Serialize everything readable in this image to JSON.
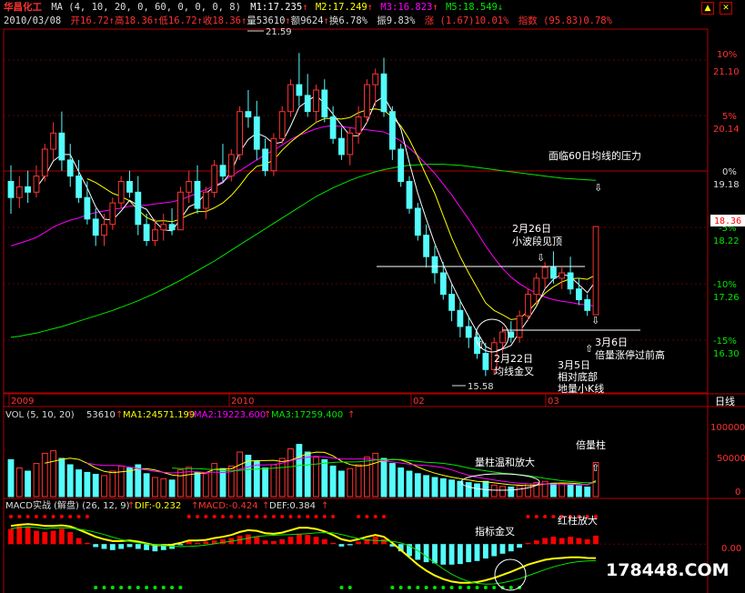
{
  "header": {
    "stock_name": "华昌化工",
    "ma_label": "MA (4, 10, 20, 0, 60, 0, 0, 0, 8)",
    "m1": "M1:17.235",
    "m2": "M2:17.249",
    "m3": "M3:16.823",
    "m5": "M5:18.549",
    "date": "2010/03/08",
    "open": "开16.72",
    "high": "高18.36",
    "low": "低16.72",
    "close": "收18.36",
    "volume": "量53610",
    "amount": "额9624",
    "turnover": "换6.78%",
    "amplitude": "振9.83%",
    "change": "涨 (1.67)10.01%",
    "index": "指数 (95.83)0.78%"
  },
  "vol_header": {
    "label": "VOL (5, 10, 20)",
    "value": "53610",
    "ma1": "MA1:24571.199",
    "ma2": "MA2:19223.600",
    "ma3": "MA3:17259.400"
  },
  "macd_header": {
    "label": "MACD实战 (解盘) (26, 12, 9)",
    "dif": "DIF:-0.232",
    "macd": "MACD:-0.424",
    "dea": "DEF:0.384"
  },
  "annotations": {
    "max_price": "21.59",
    "min_price": "15.58",
    "pressure": "面临60日均线的压力",
    "feb26": "2月26日",
    "feb26_b": "小波段见顶",
    "feb22": "2月22日",
    "feb22_b": "均线金叉",
    "mar5": "3月5日",
    "mar5_b": "相对底部",
    "mar5_c": "地量小K线",
    "mar6": "3月6日",
    "mar6_b": "倍量涨停过前高",
    "vol_mild": "量柱温和放大",
    "vol_double": "倍量柱",
    "macd_cross": "指标金叉",
    "macd_red": "红柱放大",
    "current_price": "18.36"
  },
  "time_axis": {
    "labels": [
      "2009",
      "2010",
      "02",
      "03"
    ],
    "period": "日线"
  },
  "price_axis": {
    "percent_labels": [
      "10%",
      "5%",
      "0%",
      "-5%",
      "-10%",
      "-15%"
    ],
    "price_labels": [
      "21.10",
      "20.14",
      "19.18",
      "18.22",
      "17.26",
      "16.30"
    ]
  },
  "vol_axis": [
    "100000",
    "50000",
    "0"
  ],
  "macd_axis": [
    "0.00"
  ],
  "watermark": "178448.COM",
  "window_buttons": [
    "▲",
    "✕"
  ],
  "colors": {
    "up": "#ff3232",
    "down": "#54fcfc",
    "ma4": "#ffffff",
    "ma10": "#ffff00",
    "ma20": "#ff00ff",
    "ma60": "#00e600",
    "grid": "#b00000"
  },
  "chart_data": {
    "type": "candlestick",
    "price_ylim": [
      15.3,
      22.0
    ],
    "candles": [
      [
        19.2,
        19.5,
        18.6,
        18.9
      ],
      [
        18.9,
        19.3,
        18.7,
        19.1
      ],
      [
        19.1,
        19.4,
        18.8,
        19.0
      ],
      [
        19.0,
        19.5,
        18.9,
        19.3
      ],
      [
        19.3,
        19.9,
        19.2,
        19.8
      ],
      [
        19.8,
        20.3,
        19.6,
        20.1
      ],
      [
        20.1,
        20.5,
        19.4,
        19.6
      ],
      [
        19.6,
        19.9,
        19.1,
        19.3
      ],
      [
        19.3,
        19.6,
        18.8,
        18.9
      ],
      [
        18.9,
        19.2,
        18.4,
        18.5
      ],
      [
        18.5,
        18.7,
        18.0,
        18.2
      ],
      [
        18.2,
        18.6,
        18.0,
        18.4
      ],
      [
        18.4,
        18.9,
        18.3,
        18.8
      ],
      [
        18.8,
        19.3,
        18.7,
        19.2
      ],
      [
        19.2,
        19.4,
        18.9,
        19.0
      ],
      [
        19.0,
        19.3,
        18.2,
        18.4
      ],
      [
        18.4,
        18.6,
        18.0,
        18.1
      ],
      [
        18.1,
        18.5,
        18.0,
        18.3
      ],
      [
        18.3,
        18.6,
        18.1,
        18.4
      ],
      [
        18.4,
        18.7,
        18.2,
        18.3
      ],
      [
        18.3,
        19.1,
        18.3,
        19.0
      ],
      [
        19.0,
        19.4,
        18.8,
        19.2
      ],
      [
        19.2,
        19.5,
        18.6,
        18.7
      ],
      [
        18.7,
        19.1,
        18.5,
        19.0
      ],
      [
        19.0,
        19.6,
        18.9,
        19.5
      ],
      [
        19.5,
        19.9,
        19.2,
        19.3
      ],
      [
        19.3,
        19.8,
        19.2,
        19.7
      ],
      [
        19.7,
        20.6,
        19.6,
        20.5
      ],
      [
        20.5,
        20.9,
        20.2,
        20.4
      ],
      [
        20.4,
        20.7,
        19.6,
        19.8
      ],
      [
        19.8,
        20.0,
        19.3,
        19.4
      ],
      [
        19.4,
        20.1,
        19.3,
        20.0
      ],
      [
        20.0,
        20.6,
        19.9,
        20.5
      ],
      [
        20.5,
        21.1,
        20.4,
        21.0
      ],
      [
        21.0,
        21.59,
        20.6,
        20.8
      ],
      [
        20.8,
        21.2,
        20.4,
        20.5
      ],
      [
        20.5,
        21.0,
        20.3,
        20.9
      ],
      [
        20.9,
        21.1,
        20.3,
        20.4
      ],
      [
        20.4,
        20.6,
        19.9,
        20.0
      ],
      [
        20.0,
        20.2,
        19.6,
        19.7
      ],
      [
        19.7,
        20.2,
        19.5,
        20.1
      ],
      [
        20.1,
        20.6,
        19.9,
        20.4
      ],
      [
        20.4,
        21.1,
        20.3,
        21.0
      ],
      [
        21.0,
        21.3,
        20.6,
        21.2
      ],
      [
        21.2,
        21.5,
        20.4,
        20.5
      ],
      [
        20.5,
        20.6,
        19.6,
        19.8
      ],
      [
        19.8,
        19.9,
        19.1,
        19.2
      ],
      [
        19.2,
        19.3,
        18.6,
        18.7
      ],
      [
        18.7,
        18.8,
        18.1,
        18.2
      ],
      [
        18.2,
        18.4,
        17.6,
        17.8
      ],
      [
        17.8,
        18.0,
        17.3,
        17.5
      ],
      [
        17.5,
        17.7,
        17.0,
        17.1
      ],
      [
        17.1,
        17.3,
        16.6,
        16.8
      ],
      [
        16.8,
        17.0,
        16.3,
        16.5
      ],
      [
        16.5,
        16.7,
        16.1,
        16.3
      ],
      [
        16.3,
        16.4,
        15.9,
        16.0
      ],
      [
        16.0,
        16.2,
        15.58,
        15.7
      ],
      [
        15.7,
        16.3,
        15.6,
        16.2
      ],
      [
        16.2,
        16.5,
        16.0,
        16.4
      ],
      [
        16.4,
        16.6,
        16.2,
        16.3
      ],
      [
        16.3,
        16.8,
        16.2,
        16.7
      ],
      [
        16.7,
        17.2,
        16.6,
        17.1
      ],
      [
        17.1,
        17.5,
        16.9,
        17.4
      ],
      [
        17.4,
        17.7,
        17.2,
        17.6
      ],
      [
        17.6,
        17.9,
        17.3,
        17.4
      ],
      [
        17.4,
        17.6,
        17.2,
        17.5
      ],
      [
        17.5,
        17.8,
        17.1,
        17.2
      ],
      [
        17.2,
        17.4,
        16.9,
        17.0
      ],
      [
        17.0,
        17.1,
        16.7,
        16.8
      ],
      [
        16.72,
        18.36,
        16.72,
        18.36
      ]
    ],
    "ma4": [
      null,
      null,
      null,
      19.08,
      19.3,
      19.58,
      19.7,
      19.7,
      19.38,
      19.08,
      18.73,
      18.5,
      18.48,
      18.65,
      18.85,
      18.75,
      18.68,
      18.45,
      18.3,
      18.28,
      18.5,
      18.73,
      18.8,
      18.98,
      19.1,
      19.18,
      19.38,
      19.75,
      19.98,
      20.1,
      20.03,
      19.9,
      19.93,
      20.23,
      20.58,
      20.7,
      20.8,
      20.65,
      20.45,
      20.25,
      20.05,
      20.05,
      20.3,
      20.68,
      20.78,
      20.5,
      20.18,
      19.55,
      18.98,
      18.5,
      18.05,
      17.65,
      17.3,
      16.98,
      16.68,
      16.4,
      16.13,
      16.05,
      16.08,
      16.15,
      16.4,
      16.63,
      16.88,
      17.2,
      17.38,
      17.48,
      17.43,
      17.28,
      17.13,
      17.35
    ],
    "ma10": [
      null,
      null,
      null,
      null,
      null,
      null,
      null,
      null,
      null,
      19.25,
      19.18,
      19.08,
      18.98,
      18.92,
      18.84,
      18.67,
      18.53,
      18.46,
      18.47,
      18.45,
      18.5,
      18.58,
      18.64,
      18.64,
      18.71,
      18.8,
      18.94,
      19.12,
      19.33,
      19.48,
      19.52,
      19.6,
      19.78,
      19.93,
      20.06,
      20.18,
      20.3,
      20.37,
      20.37,
      20.36,
      20.39,
      20.48,
      20.53,
      20.55,
      20.52,
      20.4,
      20.23,
      19.98,
      19.66,
      19.31,
      18.98,
      18.56,
      18.15,
      17.8,
      17.5,
      17.22,
      16.94,
      16.8,
      16.72,
      16.63,
      16.65,
      16.78,
      16.95,
      17.12,
      17.24,
      17.33,
      17.39,
      17.4,
      17.38,
      17.46
    ],
    "ma20": [
      18.0,
      18.05,
      18.1,
      18.16,
      18.25,
      18.35,
      18.42,
      18.48,
      18.52,
      18.58,
      18.62,
      18.65,
      18.68,
      18.7,
      18.74,
      18.75,
      18.76,
      18.78,
      18.8,
      18.82,
      18.86,
      18.92,
      18.98,
      19.05,
      19.12,
      19.2,
      19.3,
      19.4,
      19.5,
      19.6,
      19.7,
      19.78,
      19.88,
      19.98,
      20.06,
      20.12,
      20.18,
      20.22,
      20.24,
      20.22,
      20.2,
      20.18,
      20.16,
      20.14,
      20.12,
      20.05,
      19.95,
      19.82,
      19.68,
      19.52,
      19.35,
      19.15,
      18.95,
      18.72,
      18.5,
      18.25,
      18.0,
      17.78,
      17.58,
      17.42,
      17.3,
      17.2,
      17.12,
      17.05,
      17.0,
      16.97,
      16.95,
      16.92,
      16.9,
      16.88
    ],
    "ma60": [
      16.3,
      16.32,
      16.35,
      16.38,
      16.42,
      16.46,
      16.5,
      16.55,
      16.6,
      16.65,
      16.7,
      16.75,
      16.8,
      16.86,
      16.92,
      16.98,
      17.05,
      17.12,
      17.2,
      17.28,
      17.36,
      17.45,
      17.54,
      17.63,
      17.72,
      17.82,
      17.92,
      18.02,
      18.12,
      18.22,
      18.32,
      18.42,
      18.52,
      18.62,
      18.72,
      18.82,
      18.92,
      19.0,
      19.08,
      19.15,
      19.22,
      19.28,
      19.33,
      19.38,
      19.42,
      19.45,
      19.48,
      19.5,
      19.51,
      19.52,
      19.52,
      19.52,
      19.51,
      19.5,
      19.48,
      19.46,
      19.44,
      19.42,
      19.4,
      19.38,
      19.36,
      19.34,
      19.32,
      19.3,
      19.28,
      19.26,
      19.25,
      19.24,
      19.23,
      19.22
    ],
    "volumes": [
      58000,
      45000,
      40000,
      52000,
      68000,
      72000,
      60000,
      50000,
      42000,
      38000,
      35000,
      33000,
      40000,
      48000,
      45000,
      50000,
      36000,
      30000,
      28000,
      26000,
      42000,
      46000,
      38000,
      36000,
      52000,
      44000,
      48000,
      70000,
      65000,
      55000,
      45000,
      50000,
      60000,
      75000,
      82000,
      70000,
      62000,
      58000,
      48000,
      40000,
      44000,
      50000,
      62000,
      68000,
      60000,
      52000,
      45000,
      40000,
      36000,
      33000,
      30000,
      28000,
      26000,
      24000,
      22000,
      20000,
      24000,
      18000,
      16000,
      15000,
      17000,
      20000,
      22000,
      24000,
      21000,
      20000,
      19000,
      17000,
      15000,
      53610
    ],
    "vol_ma1": 24571.199,
    "vol_ma2": 19223.6,
    "vol_ma3": 17259.4,
    "vol_ylim": [
      0,
      120000
    ],
    "macd_hist": [
      0.25,
      0.3,
      0.28,
      0.22,
      0.2,
      0.22,
      0.25,
      0.2,
      0.1,
      0.02,
      -0.05,
      -0.08,
      -0.1,
      -0.08,
      -0.05,
      -0.08,
      -0.1,
      -0.12,
      -0.1,
      -0.08,
      -0.02,
      0.04,
      0.02,
      0.04,
      0.06,
      0.08,
      0.1,
      0.14,
      0.16,
      0.12,
      0.06,
      0.05,
      0.08,
      0.12,
      0.16,
      0.15,
      0.12,
      0.08,
      0.02,
      -0.04,
      -0.02,
      0.04,
      0.08,
      0.12,
      0.08,
      -0.04,
      -0.12,
      -0.2,
      -0.26,
      -0.3,
      -0.32,
      -0.34,
      -0.34,
      -0.33,
      -0.3,
      -0.28,
      -0.24,
      -0.2,
      -0.16,
      -0.12,
      -0.06,
      0.02,
      0.06,
      0.1,
      0.12,
      0.1,
      0.12,
      0.1,
      0.08,
      0.14
    ],
    "macd_dif": [
      0.3,
      0.32,
      0.33,
      0.32,
      0.3,
      0.3,
      0.31,
      0.29,
      0.24,
      0.18,
      0.12,
      0.08,
      0.05,
      0.05,
      0.06,
      0.04,
      0.01,
      -0.02,
      -0.02,
      -0.01,
      0.02,
      0.06,
      0.06,
      0.07,
      0.1,
      0.12,
      0.15,
      0.2,
      0.23,
      0.22,
      0.18,
      0.17,
      0.19,
      0.23,
      0.27,
      0.27,
      0.25,
      0.21,
      0.15,
      0.08,
      0.05,
      0.08,
      0.12,
      0.15,
      0.12,
      0.02,
      -0.1,
      -0.22,
      -0.34,
      -0.44,
      -0.52,
      -0.58,
      -0.62,
      -0.64,
      -0.64,
      -0.63,
      -0.6,
      -0.56,
      -0.51,
      -0.46,
      -0.4,
      -0.34,
      -0.3,
      -0.26,
      -0.24,
      -0.23,
      -0.22,
      -0.22,
      -0.23,
      -0.232
    ],
    "macd_ylim": [
      -0.75,
      0.5
    ]
  }
}
